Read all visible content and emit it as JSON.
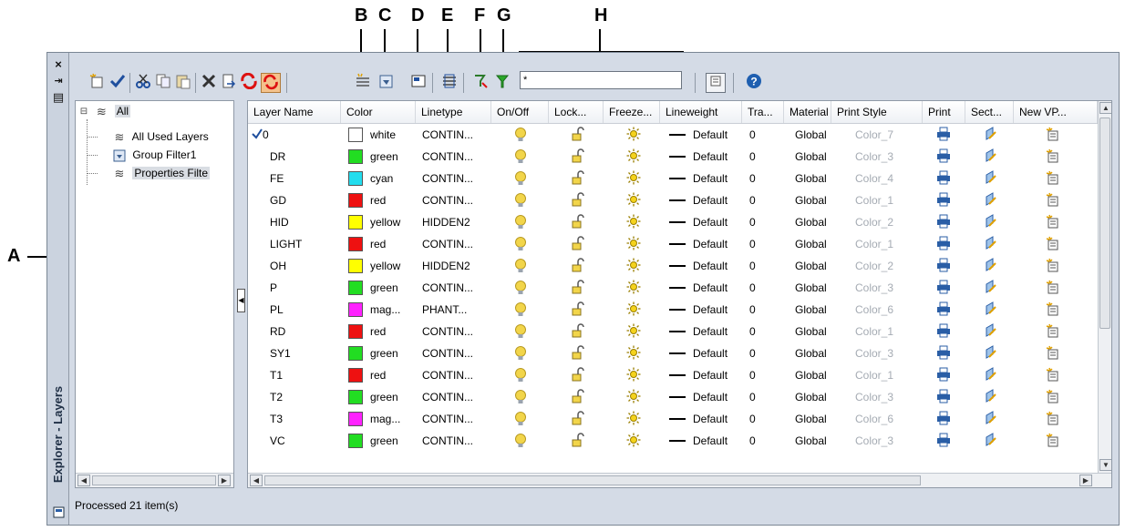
{
  "callouts": {
    "A": "A",
    "B": "B",
    "C": "C",
    "D": "D",
    "E": "E",
    "F": "F",
    "G": "G",
    "H": "H"
  },
  "sidebar": {
    "close_glyph": "×",
    "pin_glyph": "⇥",
    "props_glyph": "▤",
    "title": "Explorer - Layers"
  },
  "toolbar": {
    "search_value": "*"
  },
  "tree": {
    "root": {
      "label": "All"
    },
    "items": [
      {
        "label": "All Used Layers"
      },
      {
        "label": "Group Filter1"
      },
      {
        "label": "Properties Filte"
      }
    ]
  },
  "grid": {
    "columns": [
      "Layer Name",
      "Color",
      "Linetype",
      "On/Off",
      "Lock...",
      "Freeze...",
      "Lineweight",
      "Tra...",
      "Material",
      "Print Style",
      "Print",
      "Sect...",
      "New VP..."
    ],
    "rows": [
      {
        "name": "0",
        "color": "white",
        "hex": "#ffffff",
        "linetype": "CONTIN...",
        "lineweight": "Default",
        "tra": "0",
        "material": "Global",
        "print_style": "Color_7",
        "current": true
      },
      {
        "name": "DR",
        "color": "green",
        "hex": "#22dd22",
        "linetype": "CONTIN...",
        "lineweight": "Default",
        "tra": "0",
        "material": "Global",
        "print_style": "Color_3"
      },
      {
        "name": "FE",
        "color": "cyan",
        "hex": "#22ddee",
        "linetype": "CONTIN...",
        "lineweight": "Default",
        "tra": "0",
        "material": "Global",
        "print_style": "Color_4"
      },
      {
        "name": "GD",
        "color": "red",
        "hex": "#ee1111",
        "linetype": "CONTIN...",
        "lineweight": "Default",
        "tra": "0",
        "material": "Global",
        "print_style": "Color_1"
      },
      {
        "name": "HID",
        "color": "yellow",
        "hex": "#ffff00",
        "linetype": "HIDDEN2",
        "lineweight": "Default",
        "tra": "0",
        "material": "Global",
        "print_style": "Color_2"
      },
      {
        "name": "LIGHT",
        "color": "red",
        "hex": "#ee1111",
        "linetype": "CONTIN...",
        "lineweight": "Default",
        "tra": "0",
        "material": "Global",
        "print_style": "Color_1"
      },
      {
        "name": "OH",
        "color": "yellow",
        "hex": "#ffff00",
        "linetype": "HIDDEN2",
        "lineweight": "Default",
        "tra": "0",
        "material": "Global",
        "print_style": "Color_2"
      },
      {
        "name": "P",
        "color": "green",
        "hex": "#22dd22",
        "linetype": "CONTIN...",
        "lineweight": "Default",
        "tra": "0",
        "material": "Global",
        "print_style": "Color_3"
      },
      {
        "name": "PL",
        "color": "mag...",
        "hex": "#ff22ff",
        "linetype": "PHANT...",
        "lineweight": "Default",
        "tra": "0",
        "material": "Global",
        "print_style": "Color_6"
      },
      {
        "name": "RD",
        "color": "red",
        "hex": "#ee1111",
        "linetype": "CONTIN...",
        "lineweight": "Default",
        "tra": "0",
        "material": "Global",
        "print_style": "Color_1"
      },
      {
        "name": "SY1",
        "color": "green",
        "hex": "#22dd22",
        "linetype": "CONTIN...",
        "lineweight": "Default",
        "tra": "0",
        "material": "Global",
        "print_style": "Color_3"
      },
      {
        "name": "T1",
        "color": "red",
        "hex": "#ee1111",
        "linetype": "CONTIN...",
        "lineweight": "Default",
        "tra": "0",
        "material": "Global",
        "print_style": "Color_1"
      },
      {
        "name": "T2",
        "color": "green",
        "hex": "#22dd22",
        "linetype": "CONTIN...",
        "lineweight": "Default",
        "tra": "0",
        "material": "Global",
        "print_style": "Color_3"
      },
      {
        "name": "T3",
        "color": "mag...",
        "hex": "#ff22ff",
        "linetype": "CONTIN...",
        "lineweight": "Default",
        "tra": "0",
        "material": "Global",
        "print_style": "Color_6"
      },
      {
        "name": "VC",
        "color": "green",
        "hex": "#22dd22",
        "linetype": "CONTIN...",
        "lineweight": "Default",
        "tra": "0",
        "material": "Global",
        "print_style": "Color_3"
      }
    ]
  },
  "status": {
    "text": "Processed 21 item(s)"
  },
  "icons": {
    "current_layer": "check-icon",
    "on_off": "lightbulb-icon",
    "lock": "unlocked-padlock-icon",
    "freeze": "sun-icon",
    "print": "printer-icon",
    "sect": "section-icon",
    "new_vp": "new-viewport-icon"
  },
  "colors": {
    "window_bg": "#d4dbe6",
    "panel_border": "#8f99a6",
    "bulb": "#f2d54a",
    "printer": "#2a5ea6",
    "disabled_text": "#a5abb3"
  }
}
